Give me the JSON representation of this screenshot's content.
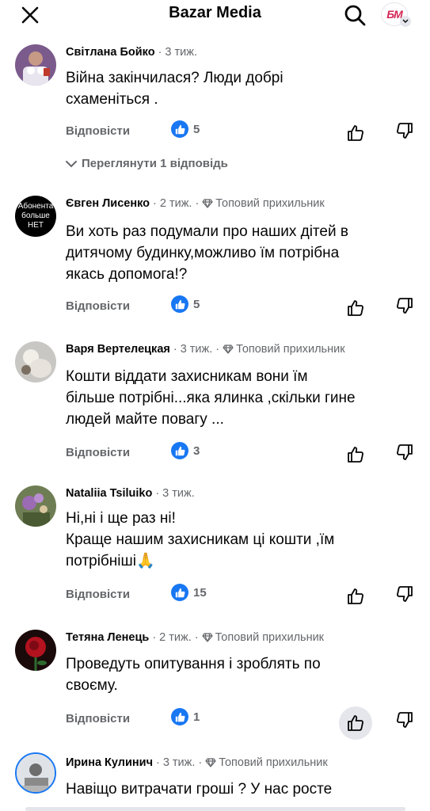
{
  "header": {
    "title": "Bazar Media",
    "close_icon": "close-icon",
    "search_icon": "search-icon",
    "profile_logo_text": "БМ",
    "brand_color": "#d42a57"
  },
  "colors": {
    "text": "#050505",
    "muted": "#65676b",
    "like_blue": "#1877f2",
    "hover_bg": "#e4e6eb"
  },
  "comments": [
    {
      "author": "Світлана Бойко",
      "time": "3 тиж.",
      "badge": "",
      "text_lines": [
        "Війна закінчилася? Люди добрі",
        "схаменіться ."
      ],
      "reply_label": "Відповісти",
      "likes": "5",
      "view_replies": "Переглянути 1 відповідь"
    },
    {
      "author": "Євген Лисенко",
      "time": "2 тиж.",
      "badge": "Топовий прихильник",
      "avatar_text": [
        "Абонента",
        "больше",
        "НЕТ"
      ],
      "text_lines": [
        "Ви хоть раз подумали про наших дітей в",
        "дитячому будинку,можливо їм потрібна",
        "якась допомога!?"
      ],
      "reply_label": "Відповісти",
      "likes": "5"
    },
    {
      "author": "Варя Вертелецкая",
      "time": "3 тиж.",
      "badge": "Топовий прихильник",
      "text_lines": [
        "Кошти віддати захисникам вони їм",
        "більше потрібні...яка ялинка ,скільки гине",
        "людей майте повагу ..."
      ],
      "reply_label": "Відповісти",
      "likes": "3"
    },
    {
      "author": "Nataliia Tsiluiko",
      "time": "3 тиж.",
      "badge": "",
      "text_lines": [
        "Ні,ні і ще раз ні!",
        "Краще нашим захисникам ці кошти ,їм",
        "потрібніші🙏"
      ],
      "reply_label": "Відповісти",
      "likes": "15"
    },
    {
      "author": "Тетяна Ленець",
      "time": "2 тиж.",
      "badge": "Топовий прихильник",
      "text_lines": [
        "Проведуть опитування і зроблять по",
        "своєму."
      ],
      "reply_label": "Відповісти",
      "likes": "1"
    },
    {
      "author": "Ирина Кулинич",
      "time": "3 тиж.",
      "badge": "Топовий прихильник",
      "text_lines": [
        "Навіщо витрачати гроші ? У нас росте"
      ]
    }
  ]
}
